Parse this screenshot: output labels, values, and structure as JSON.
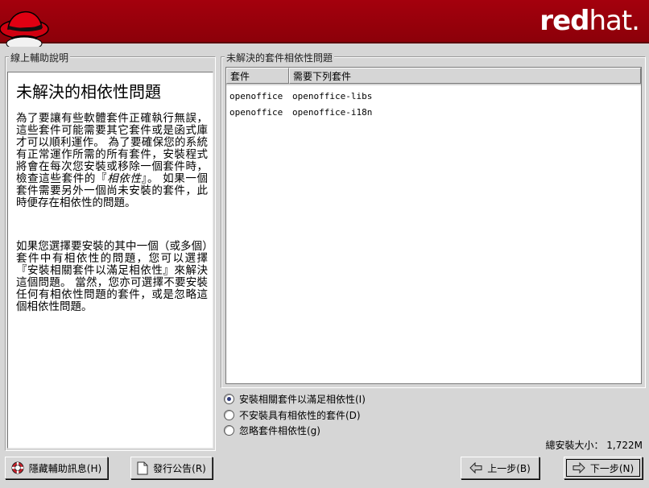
{
  "brand": {
    "logo_text_bold": "red",
    "logo_text_thin": "hat."
  },
  "help_panel": {
    "label": "線上輔助說明",
    "title": "未解決的相依性問題",
    "p1_a": "為了要讓有些軟體套件正確執行無誤，這些套件可能需要其它套件或是函式庫才可以順利運作。 為了要確保您的系統有正常運作所需的所有套件，安裝程式將會在每次您安裝或移除一個套件時，檢查這些套件的『",
    "p1_em": "相依性",
    "p1_b": "』。 如果一個套件需要另外一個尚未安裝的套件，此時便存在相依性的問題。",
    "p2": "如果您選擇要安裝的其中一個（或多個）套件中有相依性的問題，您可以選擇『安裝相關套件以滿足相依性』來解決這個問題。 當然，您亦可選擇不要安裝任何有相依性問題的套件，或是忽略這個相依性問題。"
  },
  "deps_panel": {
    "label": "未解決的套件相依性問題",
    "columns": [
      "套件",
      "需要下列套件"
    ],
    "rows": [
      [
        "openoffice",
        "openoffice-libs"
      ],
      [
        "openoffice",
        "openoffice-i18n"
      ]
    ]
  },
  "options": [
    {
      "label": "安裝相關套件以滿足相依性(I)",
      "selected": true
    },
    {
      "label": "不安裝具有相依性的套件(D)",
      "selected": false
    },
    {
      "label": "忽略套件相依性(g)",
      "selected": false
    }
  ],
  "total_size": "總安裝大小： 1,722M",
  "buttons": {
    "hide_help": "隱藏輔助訊息(H)",
    "release_notes": "發行公告(R)",
    "back": "上一步(B)",
    "next": "下一步(N)"
  },
  "colors": {
    "banner": "#a4000d",
    "background": "#d6d6d6",
    "radio_dot": "#2f3b7a"
  }
}
